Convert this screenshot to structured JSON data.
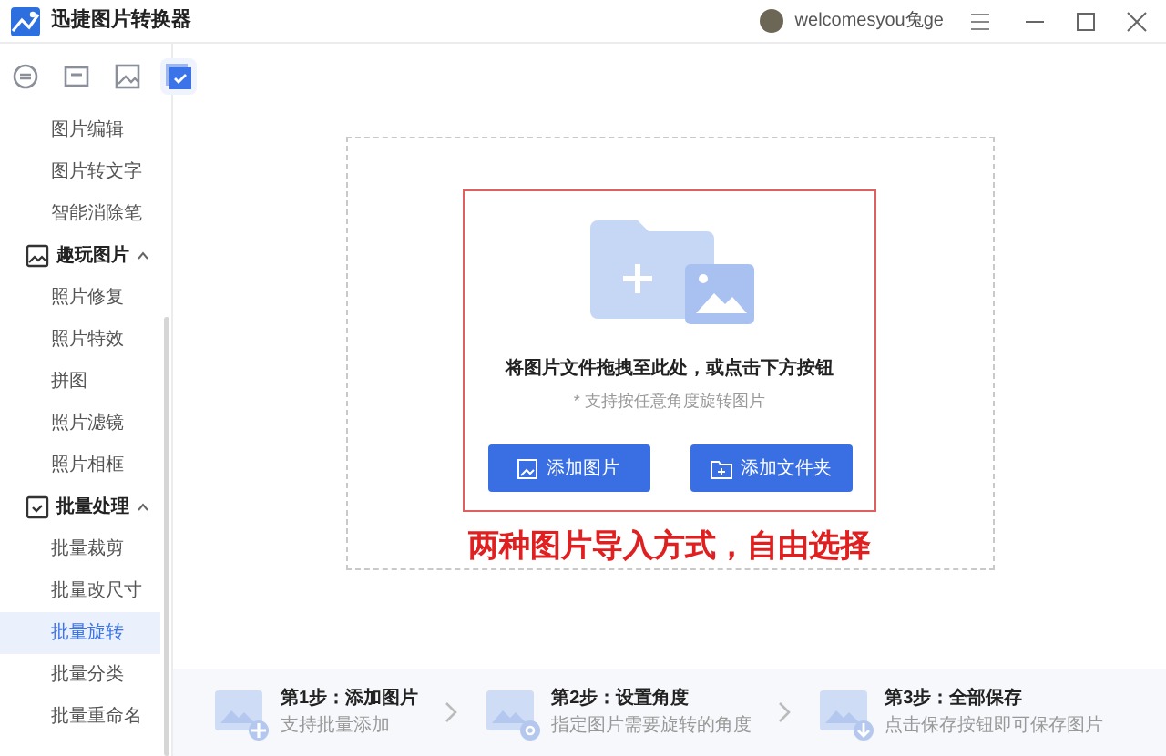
{
  "window": {
    "title": "迅捷图片转换器",
    "user": "welcomesyou兔ge"
  },
  "sidebar": {
    "tabs": [
      {
        "kind": "convert",
        "selected": false
      },
      {
        "kind": "photo",
        "selected": false
      },
      {
        "kind": "image",
        "selected": false
      },
      {
        "kind": "batch",
        "selected": true
      }
    ],
    "items": [
      {
        "kind": "item",
        "label": "图片编辑",
        "selected": false
      },
      {
        "kind": "item",
        "label": "图片转文字",
        "selected": false
      },
      {
        "kind": "item",
        "label": "智能消除笔",
        "selected": false
      },
      {
        "kind": "image-group",
        "label": "趣玩图片",
        "expanded": true
      },
      {
        "kind": "item",
        "label": "照片修复",
        "selected": false
      },
      {
        "kind": "item",
        "label": "照片特效",
        "selected": false
      },
      {
        "kind": "item",
        "label": "拼图",
        "selected": false
      },
      {
        "kind": "item",
        "label": "照片滤镜",
        "selected": false
      },
      {
        "kind": "item",
        "label": "照片相框",
        "selected": false
      },
      {
        "kind": "batch-group",
        "label": "批量处理",
        "expanded": true
      },
      {
        "kind": "item",
        "label": "批量裁剪",
        "selected": false
      },
      {
        "kind": "item",
        "label": "批量改尺寸",
        "selected": false
      },
      {
        "kind": "item",
        "label": "批量旋转",
        "selected": true
      },
      {
        "kind": "item",
        "label": "批量分类",
        "selected": false
      },
      {
        "kind": "item",
        "label": "批量重命名",
        "selected": false
      }
    ]
  },
  "dropzone": {
    "title": "将图片文件拖拽至此处，或点击下方按钮",
    "hint": "* 支持按任意角度旋转图片",
    "buttons": [
      {
        "kind": "image",
        "label": "添加图片"
      },
      {
        "kind": "folder",
        "label": "添加文件夹"
      }
    ]
  },
  "annotation": "两种图片导入方式，自由选择",
  "steps": [
    {
      "kind": "add",
      "title": "第1步：添加图片",
      "subtitle": "支持批量添加"
    },
    {
      "kind": "rotate",
      "title": "第2步：设置角度",
      "subtitle": "指定图片需要旋转的角度"
    },
    {
      "kind": "save",
      "title": "第3步：全部保存",
      "subtitle": "点击保存按钮即可保存图片"
    }
  ]
}
